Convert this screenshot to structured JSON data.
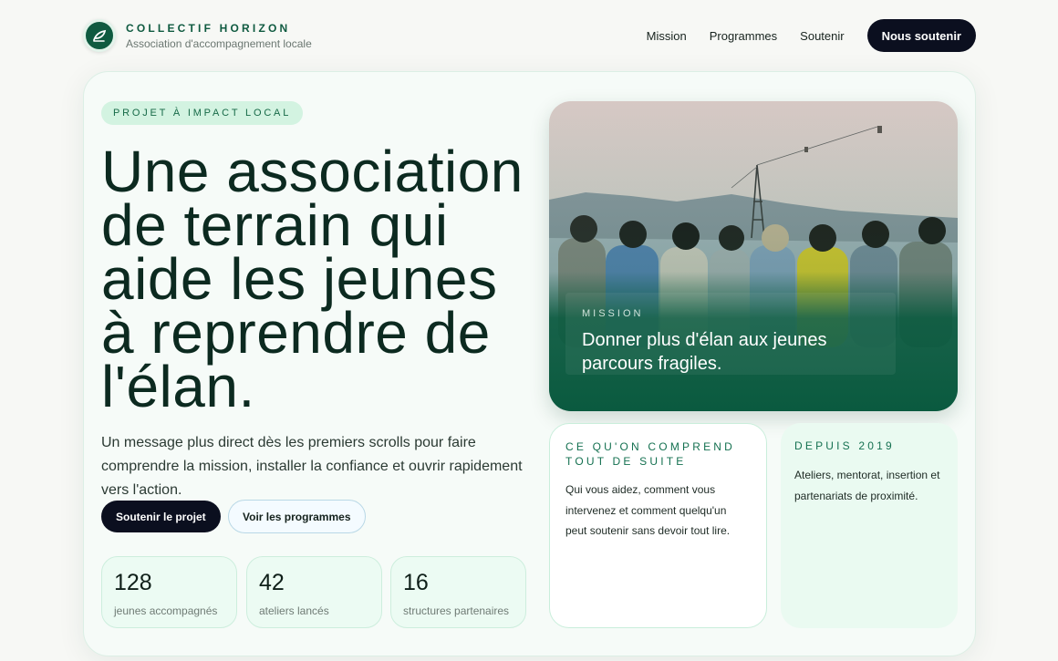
{
  "brand": {
    "name": "COLLECTIF HORIZON",
    "tagline": "Association d'accompagnement locale",
    "logo_icon": "leaf-icon"
  },
  "nav": {
    "links": [
      "Mission",
      "Programmes",
      "Soutenir"
    ],
    "cta": "Nous soutenir"
  },
  "hero": {
    "badge": "PROJET À IMPACT LOCAL",
    "title": "Une association de terrain qui aide les jeunes à reprendre de l'élan.",
    "lede": "Un message plus direct dès les premiers scrolls pour faire comprendre la mission, installer la confiance et ouvrir rapidement vers l'action.",
    "primary_button": "Soutenir le projet",
    "secondary_button": "Voir les programmes",
    "stats": [
      {
        "value": "128",
        "label": "jeunes accompagnés"
      },
      {
        "value": "42",
        "label": "ateliers lancés"
      },
      {
        "value": "16",
        "label": "structures partenaires"
      }
    ]
  },
  "mission": {
    "kicker": "MISSION",
    "text": "Donner plus d'élan aux jeunes parcours fragiles."
  },
  "cards": {
    "understand": {
      "kicker": "CE QU'ON COMPREND TOUT DE SUITE",
      "body": "Qui vous aidez, comment vous intervenez et comment quelqu'un peut soutenir sans devoir tout lire."
    },
    "since": {
      "kicker": "DEPUIS 2019",
      "body": "Ateliers, mentorat, insertion et partenariats de proximité."
    }
  },
  "colors": {
    "brand_green": "#0f5a40",
    "dark_button": "#0b0f1f",
    "mint": "#d3f3e1",
    "mission_green": "#0b5a40"
  }
}
